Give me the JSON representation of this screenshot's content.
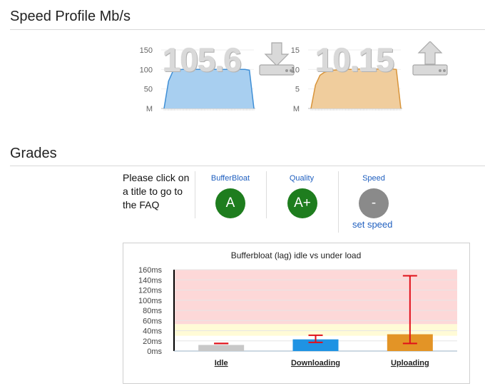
{
  "speed_section": {
    "title": "Speed Profile Mb/s",
    "download": {
      "value": "105.6",
      "y_ticks": [
        "150",
        "100",
        "50",
        "M"
      ],
      "profile": [
        0,
        70,
        96,
        99,
        100,
        100,
        100,
        100,
        100,
        100,
        100,
        100,
        100,
        100,
        100,
        100,
        100,
        100,
        100,
        98,
        0
      ],
      "max": 150,
      "fill": "#a8cff0",
      "stroke": "#3f8fd6",
      "icon": "download-icon"
    },
    "upload": {
      "value": "10.15",
      "y_ticks": [
        "15",
        "10",
        "5",
        "M"
      ],
      "profile": [
        0,
        6,
        8.5,
        9.3,
        9.6,
        9.8,
        9.9,
        10,
        10,
        10,
        10.1,
        10.1,
        10.1,
        10.1,
        10.1,
        10.1,
        10.1,
        10.1,
        10.1,
        10.0,
        0
      ],
      "max": 15,
      "fill": "#f0cd9d",
      "stroke": "#d8943a",
      "icon": "upload-icon"
    }
  },
  "grades_section": {
    "title": "Grades",
    "note": "Please click on a title to go to the FAQ",
    "grades": [
      {
        "label": "BufferBloat",
        "value": "A",
        "color": "#1e7d1e"
      },
      {
        "label": "Quality",
        "value": "A+",
        "color": "#1e7d1e"
      },
      {
        "label": "Speed",
        "value": "-",
        "color": "#8a8a8a"
      }
    ],
    "set_speed": "set speed"
  },
  "chart_data": {
    "type": "bar",
    "title": "Bufferbloat (lag) idle vs under load",
    "categories": [
      "Idle",
      "Downloading",
      "Uploading"
    ],
    "values": [
      12,
      23,
      33
    ],
    "error_low": [
      15,
      17,
      15
    ],
    "error_high": [
      15,
      31,
      148
    ],
    "bar_colors": [
      "#c8c8c8",
      "#1f93e3",
      "#e39426"
    ],
    "error_color": "#e0101a",
    "y_ticks": [
      "160ms",
      "140ms",
      "120ms",
      "100ms",
      "80ms",
      "60ms",
      "40ms",
      "20ms",
      "0ms"
    ],
    "tick_values": [
      160,
      140,
      120,
      100,
      80,
      60,
      40,
      20,
      0
    ],
    "ylim": [
      0,
      160
    ],
    "bands": [
      {
        "from": 0,
        "to": 30,
        "color": "#ffffff"
      },
      {
        "from": 30,
        "to": 53,
        "color": "#fffbd6"
      },
      {
        "from": 53,
        "to": 160,
        "color": "#fdd8d8"
      }
    ],
    "grid": true
  }
}
